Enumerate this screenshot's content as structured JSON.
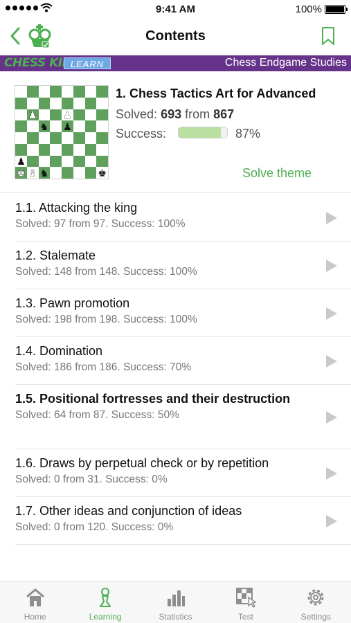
{
  "status_bar": {
    "time": "9:41 AM",
    "battery": "100%"
  },
  "nav": {
    "title": "Contents"
  },
  "banner": {
    "brand": "CHESS KING",
    "badge": "LEARN",
    "subtitle": "Chess Endgame Studies"
  },
  "theme": {
    "title": "1. Chess Tactics Art for Advanced",
    "solved_label": "Solved:",
    "solved": "693",
    "from_label": "from",
    "total": "867",
    "success_label": "Success:",
    "success_pct": "87%",
    "progress_fraction": 0.87,
    "solve_button": "Solve theme"
  },
  "lessons": [
    {
      "title": "1.1. Attacking the king",
      "sub": "Solved: 97 from 97. Success: 100%",
      "bold": false
    },
    {
      "title": "1.2. Stalemate",
      "sub": "Solved: 148 from 148. Success: 100%",
      "bold": false
    },
    {
      "title": "1.3. Pawn promotion",
      "sub": "Solved: 198 from 198. Success: 100%",
      "bold": false
    },
    {
      "title": "1.4. Domination",
      "sub": "Solved: 186 from 186. Success: 70%",
      "bold": false
    },
    {
      "title": "1.5. Positional fortresses and their destruction",
      "sub": "Solved: 64 from 87. Success: 50%",
      "bold": true
    },
    {
      "title": "1.6. Draws by perpetual check or by repetition",
      "sub": "Solved: 0 from 31. Success: 0%",
      "bold": false
    },
    {
      "title": "1.7. Other ideas and conjunction of ideas",
      "sub": "Solved: 0 from 120. Success: 0%",
      "bold": false
    }
  ],
  "tabs": [
    {
      "label": "Home",
      "icon": "home-icon",
      "active": false
    },
    {
      "label": "Learning",
      "icon": "pawn-icon",
      "active": true
    },
    {
      "label": "Statistics",
      "icon": "statistics-icon",
      "active": false
    },
    {
      "label": "Test",
      "icon": "test-icon",
      "active": false
    },
    {
      "label": "Settings",
      "icon": "gear-icon",
      "active": false
    }
  ],
  "colors": {
    "accent": "#4caf50",
    "banner": "#66328a",
    "learn_badge": "#6ea9e6",
    "board_dark": "#5fa05c"
  },
  "board_pieces": [
    {
      "square": "b3",
      "piece": "pawn",
      "color": "white"
    },
    {
      "square": "e3",
      "piece": "pawn",
      "color": "white"
    },
    {
      "square": "c4",
      "piece": "knight",
      "color": "black"
    },
    {
      "square": "e4",
      "piece": "pawn",
      "color": "black"
    },
    {
      "square": "a7",
      "piece": "pawn",
      "color": "black"
    },
    {
      "square": "a8",
      "piece": "king",
      "color": "white"
    },
    {
      "square": "b8",
      "piece": "bishop",
      "color": "white"
    },
    {
      "square": "c8",
      "piece": "knight",
      "color": "black"
    },
    {
      "square": "h8",
      "piece": "king",
      "color": "black"
    }
  ]
}
